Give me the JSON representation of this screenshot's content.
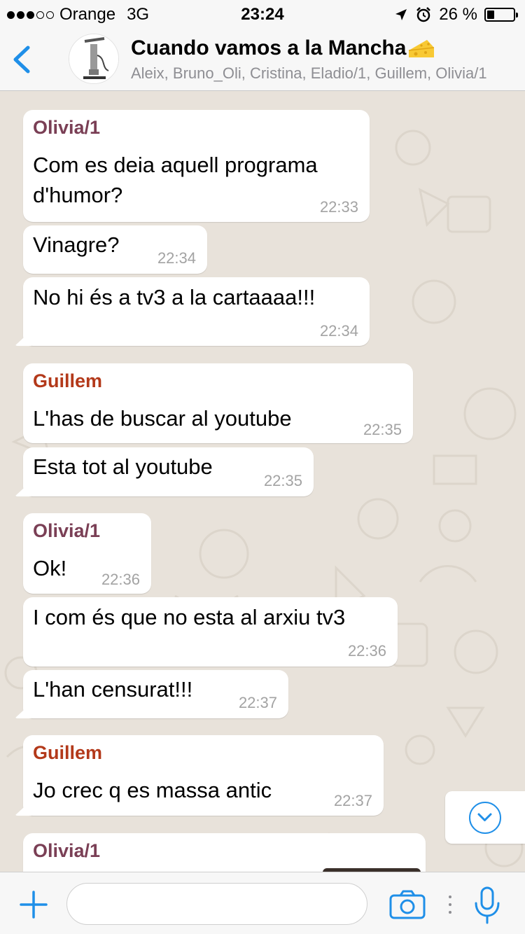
{
  "status_bar": {
    "carrier": "Orange",
    "network": "3G",
    "time": "23:24",
    "battery": "26 %",
    "battery_level": 0.26,
    "signal_bars_filled": 3,
    "signal_bars_total": 5
  },
  "header": {
    "title": "Cuando vamos a la Mancha",
    "title_emoji": "cheese-emoji",
    "subtitle": "Aleix, Bruno_Oli, Cristina, Eladio/1, Guillem, Olivia/1"
  },
  "colors": {
    "accent": "#1f8fe8",
    "olivia": "#7a3f55",
    "guillem": "#b3391a",
    "bubble": "#ffffff",
    "wallpaper": "#e8e2da"
  },
  "messages": [
    {
      "sender": "Olivia/1",
      "lines": [
        "Com es deia aquell programa",
        "d'humor?"
      ],
      "time": "22:33"
    },
    {
      "text": "Vinagre?",
      "time": "22:34"
    },
    {
      "text": "No hi és a tv3 a la cartaaaa!!!",
      "time": "22:34"
    },
    {
      "sender": "Guillem",
      "text": "L'has de buscar al youtube",
      "time": "22:35"
    },
    {
      "text": "Esta tot al youtube",
      "time": "22:35"
    },
    {
      "sender": "Olivia/1",
      "text": "Ok!",
      "time": "22:36"
    },
    {
      "text": "I com és que no esta al arxiu tv3",
      "time": "22:36"
    },
    {
      "text": "L'han censurat!!!",
      "time": "22:37"
    },
    {
      "sender": "Guillem",
      "text": "Jo crec q es massa antic",
      "time": "22:37"
    },
    {
      "sender": "Olivia/1"
    }
  ],
  "input": {
    "placeholder": "",
    "value": ""
  }
}
